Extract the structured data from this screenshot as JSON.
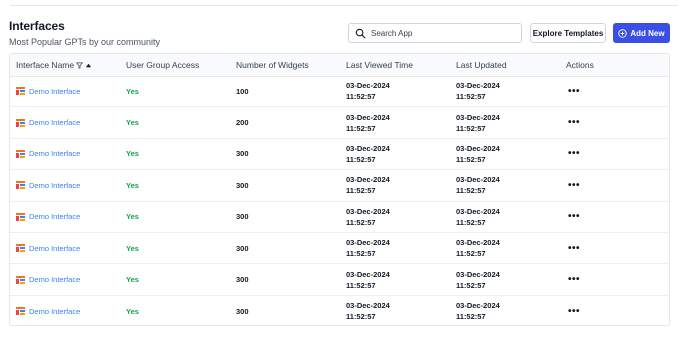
{
  "header": {
    "title": "Interfaces",
    "subtitle": "Most Popular GPTs by our community"
  },
  "search": {
    "placeholder": "Search App",
    "value": ""
  },
  "buttons": {
    "explore": "Explore Templates",
    "add": "Add New"
  },
  "colors": {
    "primary": "#3b4ee6",
    "link": "#3b82f6",
    "success": "#16a34a"
  },
  "table": {
    "columns": [
      "Interface Name",
      "User Group Access",
      "Number of Widgets",
      "Last Viewed Time",
      "Last Updated",
      "Actions"
    ],
    "sort": {
      "column": "Interface Name",
      "direction": "ascending",
      "filter_icon": "filter-icon"
    },
    "rows": [
      {
        "name": "Demo Interface",
        "access": "Yes",
        "widgets": "100",
        "viewed_date": "03-Dec-2024",
        "viewed_time": "11:52:57",
        "updated_date": "03-Dec-2024",
        "updated_time": "11:52:57",
        "actions": "•••"
      },
      {
        "name": "Demo Interface",
        "access": "Yes",
        "widgets": "200",
        "viewed_date": "03-Dec-2024",
        "viewed_time": "11:52:57",
        "updated_date": "03-Dec-2024",
        "updated_time": "11:52:57",
        "actions": "•••"
      },
      {
        "name": "Demo Interface",
        "access": "Yes",
        "widgets": "300",
        "viewed_date": "03-Dec-2024",
        "viewed_time": "11:52:57",
        "updated_date": "03-Dec-2024",
        "updated_time": "11:52:57",
        "actions": "•••"
      },
      {
        "name": "Demo Interface",
        "access": "Yes",
        "widgets": "300",
        "viewed_date": "03-Dec-2024",
        "viewed_time": "11:52:57",
        "updated_date": "03-Dec-2024",
        "updated_time": "11:52:57",
        "actions": "•••"
      },
      {
        "name": "Demo Interface",
        "access": "Yes",
        "widgets": "300",
        "viewed_date": "03-Dec-2024",
        "viewed_time": "11:52:57",
        "updated_date": "03-Dec-2024",
        "updated_time": "11:52:57",
        "actions": "•••"
      },
      {
        "name": "Demo Interface",
        "access": "Yes",
        "widgets": "300",
        "viewed_date": "03-Dec-2024",
        "viewed_time": "11:52:57",
        "updated_date": "03-Dec-2024",
        "updated_time": "11:52:57",
        "actions": "•••"
      },
      {
        "name": "Demo Interface",
        "access": "Yes",
        "widgets": "300",
        "viewed_date": "03-Dec-2024",
        "viewed_time": "11:52:57",
        "updated_date": "03-Dec-2024",
        "updated_time": "11:52:57",
        "actions": "•••"
      },
      {
        "name": "Demo Interface",
        "access": "Yes",
        "widgets": "300",
        "viewed_date": "03-Dec-2024",
        "viewed_time": "11:52:57",
        "updated_date": "03-Dec-2024",
        "updated_time": "11:52:57",
        "actions": "•••"
      }
    ]
  }
}
